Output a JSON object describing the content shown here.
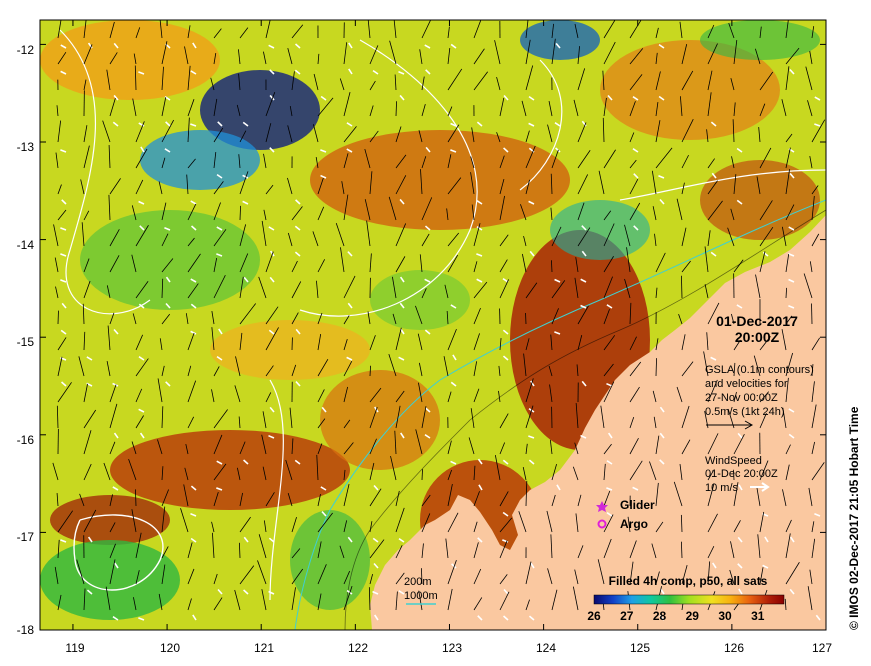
{
  "map": {
    "lat_ticks": [
      "-12",
      "-13",
      "-14",
      "-15",
      "-16",
      "-17",
      "-18"
    ],
    "lon_ticks": [
      "119",
      "120",
      "121",
      "122",
      "123",
      "124",
      "125",
      "126",
      "127"
    ],
    "lat_range": [
      -18,
      -11.75
    ],
    "lon_range": [
      118.65,
      127
    ],
    "colors": {
      "land": "#fac8a0",
      "glider": "#d02ad8",
      "argo": "#e020d8"
    }
  },
  "annotations": {
    "datetime_line1": "01-Dec-2017",
    "datetime_line2": "20:00Z",
    "gsla_line1": "GSLA (0.1m contours)",
    "gsla_line2": "and velocities for",
    "gsla_line3": "27-Nov 00:00Z",
    "gsla_line4": "0.5m/s (1kt 24h)",
    "wind_line1": "WindSpeed",
    "wind_line2": "01-Dec 20:00Z",
    "wind_line3": "10 m/s",
    "legend_glider": "Glider",
    "legend_argo": "Argo",
    "bathy_200": "200m",
    "bathy_1000": "1000m",
    "colorbar_title": "Filled 4h comp, p50, all sats",
    "colorbar_ticks": [
      "26",
      "27",
      "28",
      "29",
      "30",
      "31"
    ],
    "credit": "© IMOS 02-Dec-2017 21:05 Hobart Time"
  },
  "colorbar": {
    "range": [
      26,
      31.8
    ],
    "stops": [
      "#0a0a6e",
      "#1040c8",
      "#1ea0e6",
      "#10c8a0",
      "#30c040",
      "#a0e020",
      "#f0e020",
      "#f8b010",
      "#e86010",
      "#b02008",
      "#8a0000"
    ]
  }
}
